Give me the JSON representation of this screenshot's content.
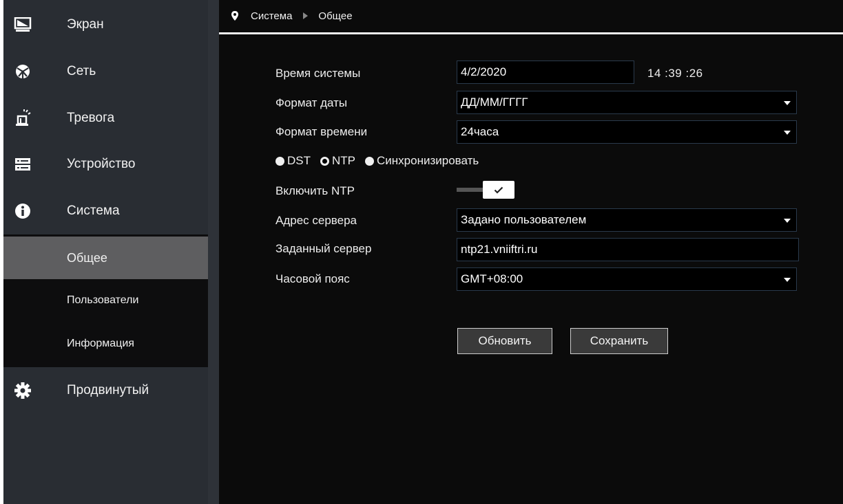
{
  "sidebar": {
    "items": [
      {
        "label": "Экран",
        "icon": "monitor-icon"
      },
      {
        "label": "Сеть",
        "icon": "network-icon"
      },
      {
        "label": "Тревога",
        "icon": "alarm-icon"
      },
      {
        "label": "Устройство",
        "icon": "device-icon"
      },
      {
        "label": "Система",
        "icon": "info-icon"
      },
      {
        "label": "Продвинутый",
        "icon": "gear-icon"
      }
    ],
    "submenu": [
      {
        "label": "Общее",
        "active": true
      },
      {
        "label": "Пользователи",
        "active": false
      },
      {
        "label": "Информация",
        "active": false
      }
    ]
  },
  "breadcrumb": {
    "level1": "Система",
    "level2": "Общее"
  },
  "form": {
    "system_time": {
      "label": "Время системы",
      "date": "4/2/2020",
      "time": "14 :39 :26"
    },
    "date_format": {
      "label": "Формат даты",
      "value": "ДД/ММ/ГГГГ"
    },
    "time_format": {
      "label": "Формат времени",
      "value": "24часа"
    },
    "modes": [
      {
        "label": "DST",
        "selected": false
      },
      {
        "label": "NTP",
        "selected": true
      },
      {
        "label": "Синхронизировать",
        "selected": false
      }
    ],
    "enable_ntp": {
      "label": "Включить NTP",
      "enabled": true
    },
    "server_address": {
      "label": "Адрес сервера",
      "value": "Задано пользователем"
    },
    "custom_server": {
      "label": "Заданный сервер",
      "value": "ntp21.vniiftri.ru"
    },
    "timezone": {
      "label": "Часовой пояс",
      "value": "GMT+08:00"
    }
  },
  "buttons": {
    "refresh": "Обновить",
    "save": "Сохранить"
  },
  "colors": {
    "sidebar_bg": "#292d33",
    "submenu_bg": "#0d0d0e",
    "active_bg": "#5e5e60",
    "main_bg": "#0b0b0b",
    "field_border": "#2a3a4c"
  }
}
